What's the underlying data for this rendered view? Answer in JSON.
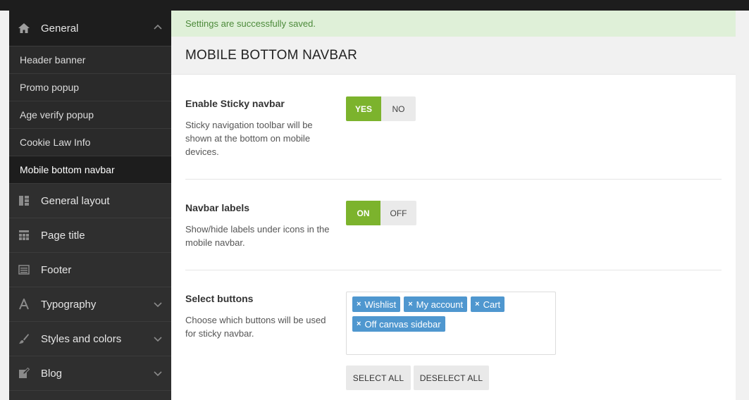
{
  "sidebar": {
    "general": {
      "label": "General",
      "icon": "home-icon"
    },
    "sub_items": [
      {
        "label": "Header banner"
      },
      {
        "label": "Promo popup"
      },
      {
        "label": "Age verify popup"
      },
      {
        "label": "Cookie Law Info"
      },
      {
        "label": "Mobile bottom navbar",
        "current": true
      }
    ],
    "items": [
      {
        "label": "General layout",
        "icon": "layout-icon"
      },
      {
        "label": "Page title",
        "icon": "page-title-icon"
      },
      {
        "label": "Footer",
        "icon": "footer-icon"
      },
      {
        "label": "Typography",
        "icon": "typography-icon",
        "expandable": true
      },
      {
        "label": "Styles and colors",
        "icon": "brush-icon",
        "expandable": true
      },
      {
        "label": "Blog",
        "icon": "edit-icon",
        "expandable": true
      }
    ]
  },
  "notice": {
    "text": "Settings are successfully saved."
  },
  "panel": {
    "title": "MOBILE BOTTOM NAVBAR"
  },
  "options": {
    "sticky": {
      "title": "Enable Sticky navbar",
      "desc": "Sticky navigation toolbar will be shown at the bottom on mobile devices.",
      "on_label": "YES",
      "off_label": "NO",
      "value": "YES"
    },
    "labels": {
      "title": "Navbar labels",
      "desc": "Show/hide labels under icons in the mobile navbar.",
      "on_label": "ON",
      "off_label": "OFF",
      "value": "ON"
    },
    "buttons": {
      "title": "Select buttons",
      "desc": "Choose which buttons will be used for sticky navbar.",
      "selected": [
        "Wishlist",
        "My account",
        "Cart",
        "Off canvas sidebar"
      ],
      "remove_symbol": "×",
      "select_all_label": "SELECT ALL",
      "deselect_all_label": "DESELECT ALL"
    }
  },
  "colors": {
    "accent_green": "#7cb32d",
    "tag_blue": "#4f97cf",
    "sidebar_bg": "#2f2f2f",
    "notice_bg": "#dff0d8"
  }
}
